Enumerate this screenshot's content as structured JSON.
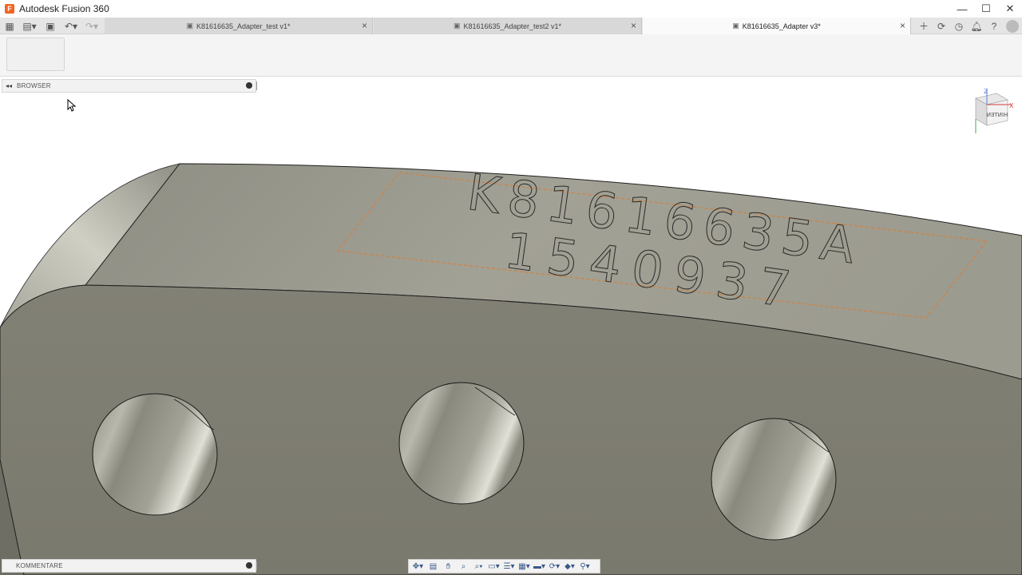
{
  "app": {
    "title": "Autodesk Fusion 360",
    "logo_letter": "F",
    "accent": "#f26522"
  },
  "window_controls": [
    {
      "name": "minimize",
      "glyph": "—"
    },
    {
      "name": "maximize",
      "glyph": "☐"
    },
    {
      "name": "close",
      "glyph": "✕"
    }
  ],
  "tabs": [
    {
      "label": "K81616635_Adapter_test v1*",
      "active": false
    },
    {
      "label": "K81616635_Adapter_test2 v1*",
      "active": false
    },
    {
      "label": "K81616635_Adapter v3*",
      "active": true
    }
  ],
  "browser_panel": {
    "label": "BROWSER"
  },
  "comments_panel": {
    "label": "KOMMENTARE"
  },
  "viewcube": {
    "face_label": "HINTEN",
    "axis_x": "X",
    "axis_z": "Z"
  },
  "model": {
    "engraving_line1": "K81616635A",
    "engraving_line2": "1540937",
    "body_color": "#7b7a70",
    "top_color": "#9b9a8e",
    "sketch_color": "#e07a2a"
  },
  "nav_tools": [
    "orbit-icon",
    "look-at-icon",
    "pan-icon",
    "zoom-icon",
    "fit-icon",
    "display-settings-icon",
    "grid-icon",
    "viewports-icon",
    "effects-icon",
    "rotate-icon",
    "appearance-icon",
    "section-icon"
  ]
}
